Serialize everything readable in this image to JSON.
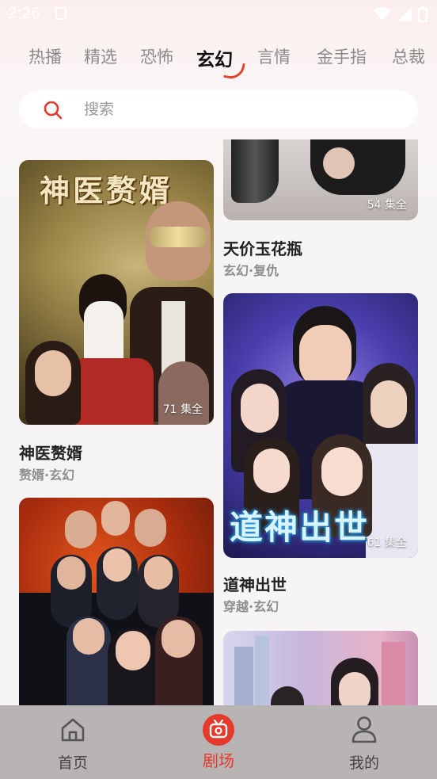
{
  "status_bar": {
    "time": "2:26"
  },
  "tabs": [
    {
      "label": "热播",
      "active": false
    },
    {
      "label": "精选",
      "active": false
    },
    {
      "label": "恐怖",
      "active": false
    },
    {
      "label": "玄幻",
      "active": true
    },
    {
      "label": "言情",
      "active": false
    },
    {
      "label": "金手指",
      "active": false
    },
    {
      "label": "总裁",
      "active": false
    }
  ],
  "search": {
    "placeholder": "搜索"
  },
  "cards": [
    {
      "title": "神医赘婿",
      "tags": "赘婿·玄幻",
      "episodes": "71 集全",
      "poster_text": "神医赘婿"
    },
    {
      "title": "天价玉花瓶",
      "tags": "玄幻·复仇",
      "episodes": "54 集全"
    },
    {
      "title": "道神出世",
      "tags": "穿越·玄幻",
      "episodes": "61 集全",
      "poster_text": "道神出世"
    },
    {
      "title": "",
      "tags": "",
      "episodes": ""
    },
    {
      "title": "",
      "tags": "",
      "episodes": ""
    }
  ],
  "bottom_nav": [
    {
      "label": "首页",
      "icon": "home-icon",
      "active": false
    },
    {
      "label": "剧场",
      "icon": "theater-icon",
      "active": true
    },
    {
      "label": "我的",
      "icon": "profile-icon",
      "active": false
    }
  ],
  "colors": {
    "accent": "#e5392c",
    "nav_bg": "#b8b4b4"
  }
}
